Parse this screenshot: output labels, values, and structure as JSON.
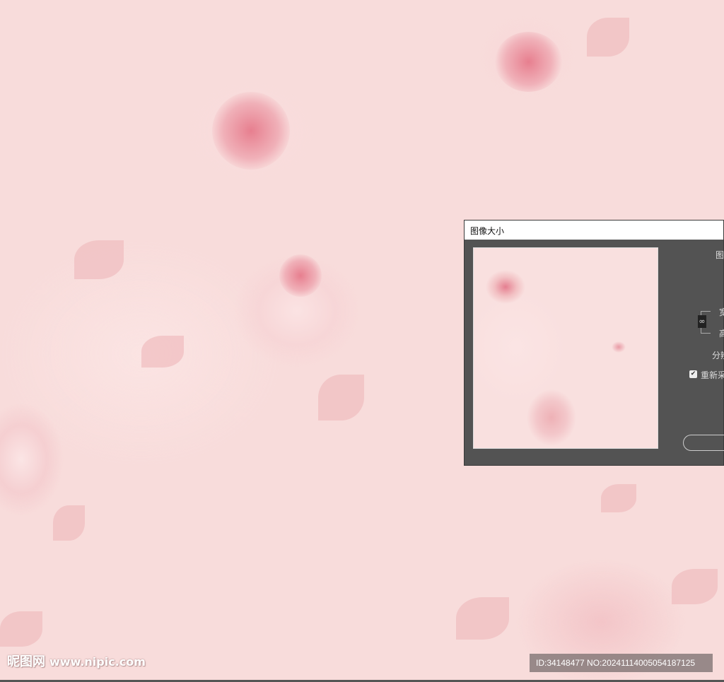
{
  "dialog": {
    "title": "图像大小",
    "labels": {
      "image_size": "图",
      "width": "宽",
      "height": "高",
      "resolution": "分辨",
      "resample": "重新采"
    },
    "resample_checked": true,
    "link_icon": "chain-link-icon"
  },
  "watermark": {
    "logo_text": "昵图网",
    "url": "www.nipic.com"
  },
  "image_id": "ID:34148477 NO:20241114005054187125"
}
